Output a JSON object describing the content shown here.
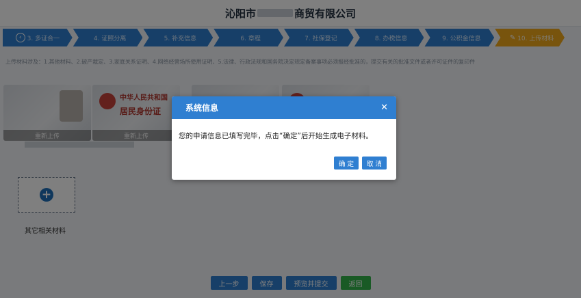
{
  "header": {
    "company_prefix": "沁阳市",
    "company_suffix": "商贸有限公司"
  },
  "steps": [
    {
      "label": "3. 多证合一",
      "icon": "back-circle-icon"
    },
    {
      "label": "4. 证照分离"
    },
    {
      "label": "5. 补充信息"
    },
    {
      "label": "6. 章程"
    },
    {
      "label": "7. 社保登记"
    },
    {
      "label": "8. 办税信息"
    },
    {
      "label": "9. 公积金信息"
    },
    {
      "label": "10. 上传材料",
      "icon": "pencil-icon",
      "active": true
    }
  ],
  "notice": "上传材料涉及：1.其他材料、2.破产裁定、3.家庭关系证明、4.网络经营场所使用证明、5.法律、行政法规和国务院决定规定备案事项必须报经批准的，提交有关的批准文件或者许可证件的复印件",
  "documents": {
    "reupload_label": "重新上传",
    "id_text_1": "中华人民共和国",
    "id_text_2": "居民身份证"
  },
  "add_material": {
    "label": "其它相关材料"
  },
  "footer": {
    "prev_label": "上一步",
    "save_label": "保存",
    "preview_label": "预览并提交",
    "return_label": "返回"
  },
  "dialog": {
    "title": "系统信息",
    "message": "您的申请信息已填写完毕，点击“确定”后开始生成电子材料。",
    "ok_label": "确 定",
    "cancel_label": "取 消"
  },
  "colors": {
    "primary": "#2f7fd1",
    "active_step": "#f0a81a",
    "return_button": "#33b44a"
  }
}
